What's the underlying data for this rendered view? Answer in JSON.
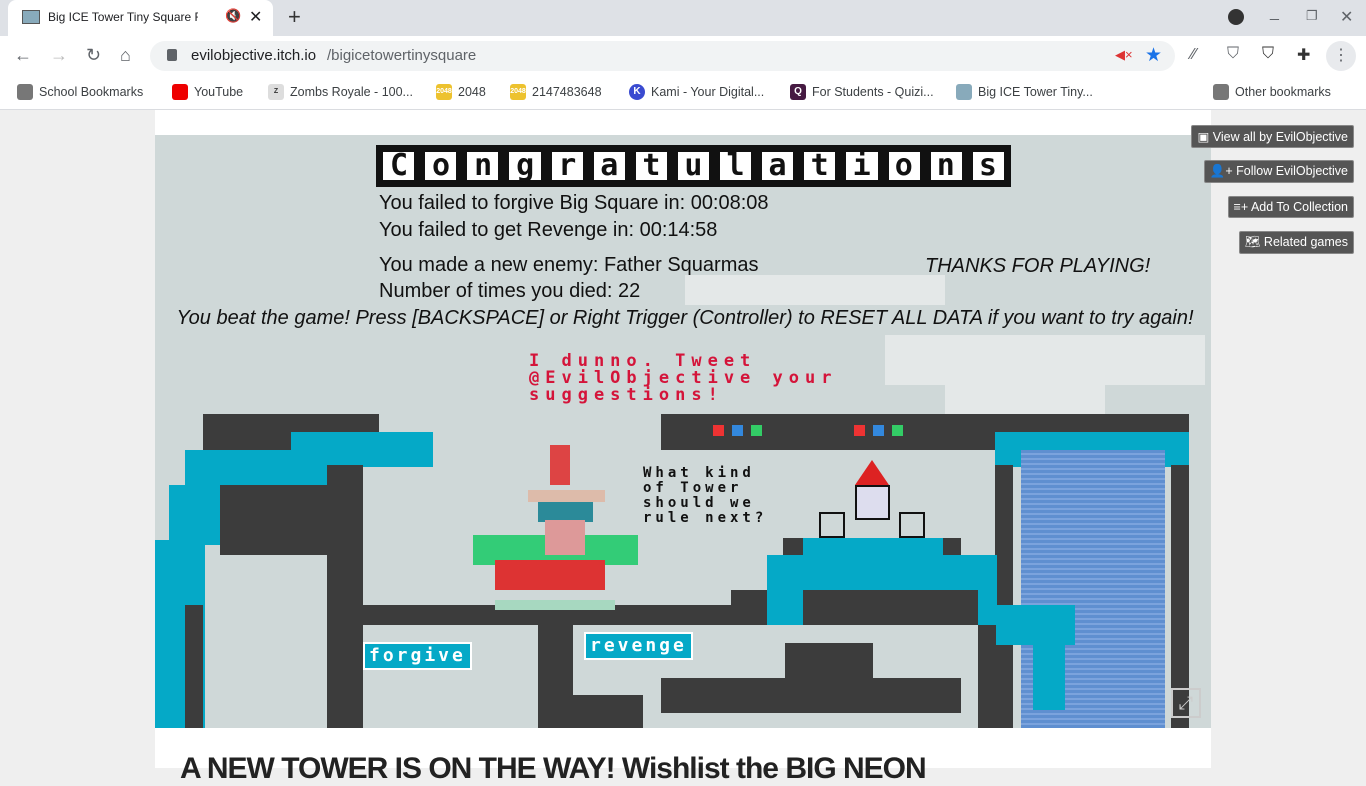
{
  "browser": {
    "tab_title": "Big ICE Tower Tiny Square Fr",
    "url_host": "evilobjective.itch.io",
    "url_path": "/bigicetowertinysquare",
    "bookmarks": [
      {
        "label": "School Bookmarks",
        "color": "#777"
      },
      {
        "label": "YouTube",
        "color": "#e00"
      },
      {
        "label": "Zombs Royale - 100...",
        "color": "#6b6"
      },
      {
        "label": "2048",
        "color": "#edc22e"
      },
      {
        "label": "2147483648",
        "color": "#edc22e"
      },
      {
        "label": "Kami - Your Digital...",
        "color": "#3a4bd0"
      },
      {
        "label": "For Students - Quizi...",
        "color": "#461a42"
      },
      {
        "label": "Big ICE Tower Tiny...",
        "color": "#8ab"
      }
    ],
    "other_bookmarks": "Other bookmarks"
  },
  "sidebar": {
    "view_all": "View all by EvilObjective",
    "follow": "Follow EvilObjective",
    "add_collection": "Add To Collection",
    "related": "Related games"
  },
  "game": {
    "title": "Congratulations",
    "line1": "You failed to forgive Big Square in: 00:08:08",
    "line2": "You failed to get Revenge in: 00:14:58",
    "line3": "You made a new enemy:  Father Squarmas",
    "line4": "Number of times you died: 22",
    "thanks": "THANKS FOR PLAYING!",
    "beat": "You beat the game! Press [BACKSPACE] or Right Trigger (Controller) to RESET ALL DATA if you want to try again!",
    "tweet": "I dunno. Tweet\n@EvilObjective your\nsuggestions!",
    "question": "What kind\nof Tower\nshould we\nrule next?",
    "forgive": "forgive",
    "revenge": "revenge"
  },
  "page": {
    "heading": "A NEW TOWER IS ON THE WAY! Wishlist the BIG NEON"
  }
}
